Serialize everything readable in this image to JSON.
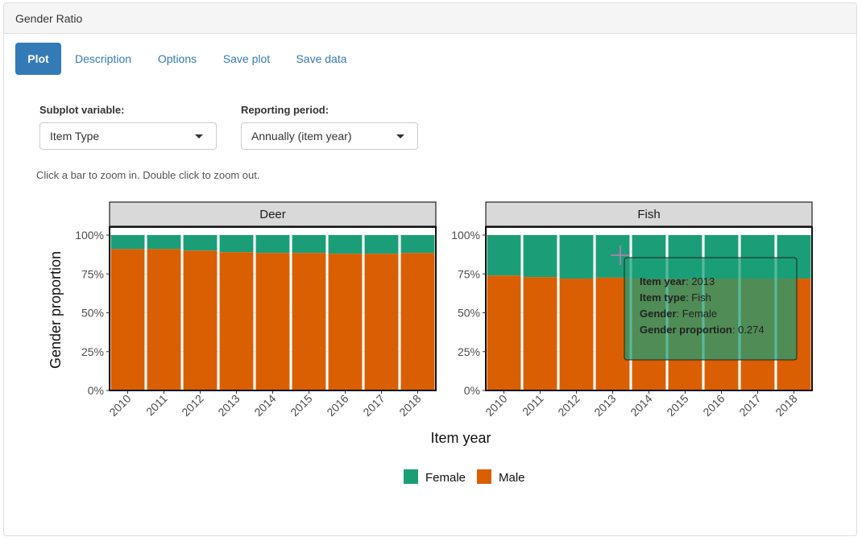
{
  "panel": {
    "title": "Gender Ratio"
  },
  "tabs": [
    {
      "label": "Plot",
      "active": true
    },
    {
      "label": "Description",
      "active": false
    },
    {
      "label": "Options",
      "active": false
    },
    {
      "label": "Save plot",
      "active": false
    },
    {
      "label": "Save data",
      "active": false
    }
  ],
  "controls": {
    "subplot": {
      "label": "Subplot variable:",
      "value": "Item Type"
    },
    "period": {
      "label": "Reporting period:",
      "value": "Annually (item year)"
    }
  },
  "hint": "Click a bar to zoom in. Double click to zoom out.",
  "colors": {
    "female": "#1b9e77",
    "male": "#d95f02",
    "strip": "#d9d9d9"
  },
  "chart_data": {
    "type": "bar",
    "stacked": true,
    "xlabel": "Item year",
    "ylabel": "Gender proportion",
    "ylim": [
      0,
      1
    ],
    "yticks": [
      "0%",
      "25%",
      "50%",
      "75%",
      "100%"
    ],
    "categories": [
      "2010",
      "2011",
      "2012",
      "2013",
      "2014",
      "2015",
      "2016",
      "2017",
      "2018"
    ],
    "legend": {
      "position": "bottom",
      "entries": [
        "Female",
        "Male"
      ]
    },
    "facets": [
      {
        "name": "Deer",
        "series": [
          {
            "name": "Female",
            "values": [
              0.09,
              0.09,
              0.1,
              0.11,
              0.115,
              0.115,
              0.12,
              0.12,
              0.115
            ]
          },
          {
            "name": "Male",
            "values": [
              0.91,
              0.91,
              0.9,
              0.89,
              0.885,
              0.885,
              0.88,
              0.88,
              0.885
            ]
          }
        ]
      },
      {
        "name": "Fish",
        "series": [
          {
            "name": "Female",
            "values": [
              0.26,
              0.27,
              0.28,
              0.274,
              0.28,
              0.28,
              0.28,
              0.28,
              0.28
            ]
          },
          {
            "name": "Male",
            "values": [
              0.74,
              0.73,
              0.72,
              0.726,
              0.72,
              0.72,
              0.72,
              0.72,
              0.72
            ]
          }
        ]
      }
    ]
  },
  "tooltip": {
    "lines": [
      {
        "key": "Item year",
        "value": ": 2013"
      },
      {
        "key": "Item type",
        "value": ": Fish"
      },
      {
        "key": "Gender",
        "value": ": Female"
      },
      {
        "key": "Gender proportion",
        "value": ": 0.274"
      }
    ]
  }
}
